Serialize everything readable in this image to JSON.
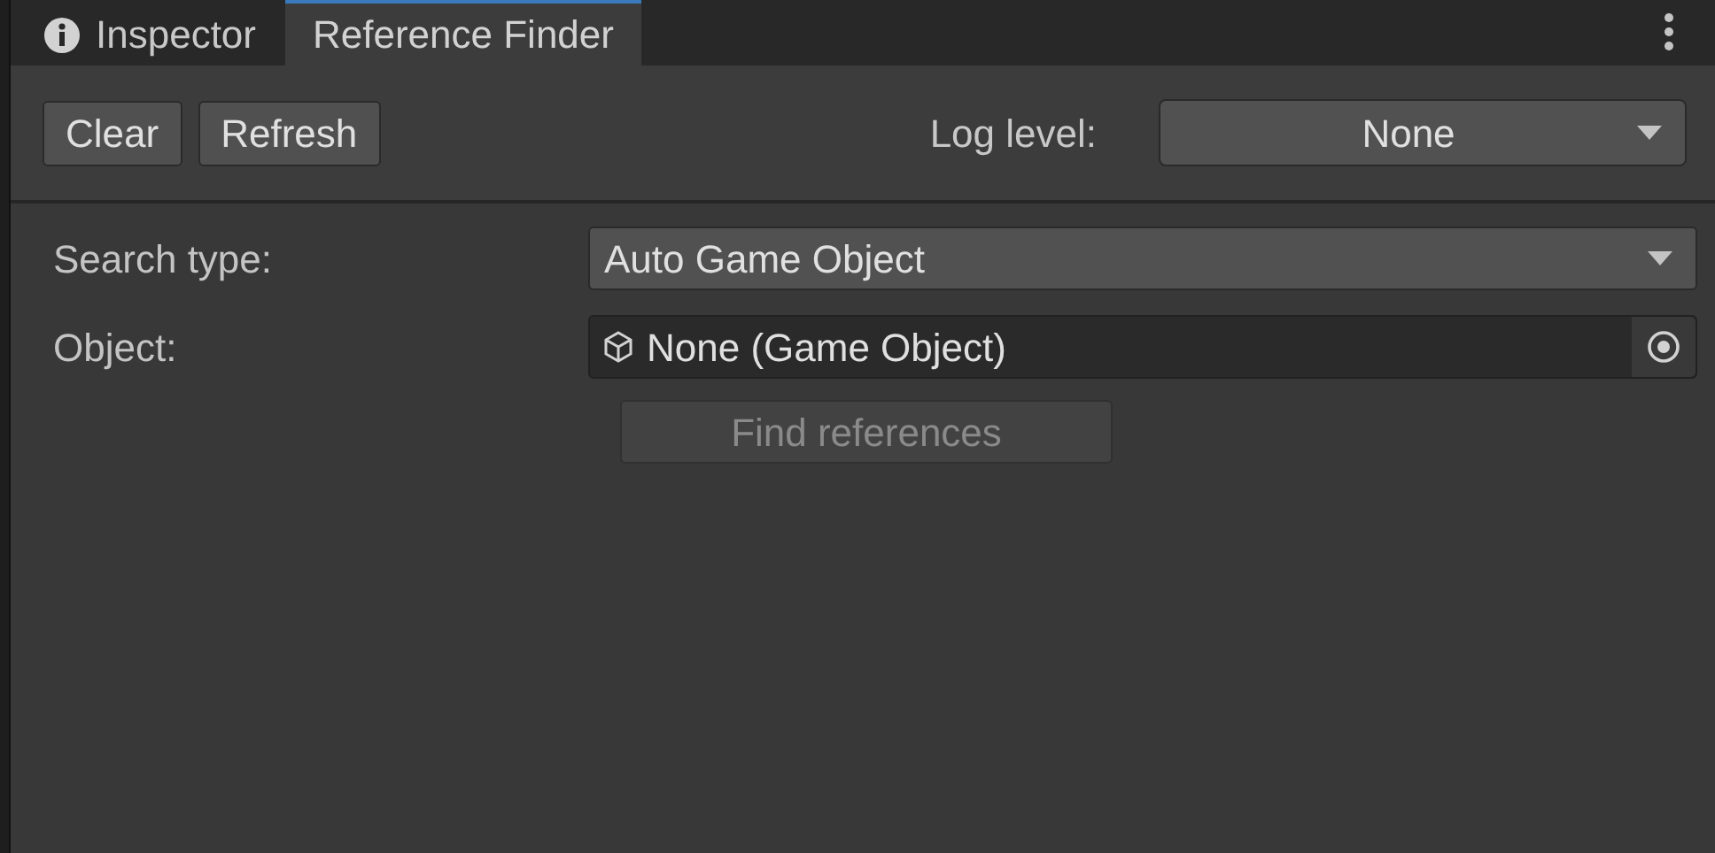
{
  "tabs": [
    {
      "label": "Inspector",
      "selected": false,
      "kind": "info"
    },
    {
      "label": "Reference Finder",
      "selected": true,
      "kind": "plain"
    }
  ],
  "toolbar": {
    "buttons": [
      "Clear",
      "Refresh"
    ],
    "log_level": {
      "label": "Log level:",
      "value": "None"
    }
  },
  "fields": [
    {
      "kind": "dropdown",
      "label": "Search type:",
      "value": "Auto Game Object"
    },
    {
      "kind": "object",
      "label": "Object:",
      "value": "None (Game Object)"
    }
  ],
  "find_button": {
    "label": "Find references",
    "disabled": true
  }
}
